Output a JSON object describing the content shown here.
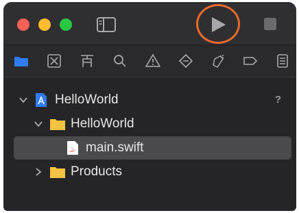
{
  "toolbar": {
    "run_icon": "play-icon",
    "stop_icon": "stop-icon",
    "sidebar_icon": "sidebar-icon"
  },
  "navigator": {
    "icons": [
      "folder-icon",
      "source-control-icon",
      "symbol-icon",
      "search-icon",
      "warning-icon",
      "test-icon",
      "debug-icon",
      "breakpoint-icon",
      "report-icon"
    ],
    "accent": "#2f7df6"
  },
  "tree": {
    "project": {
      "label": "HelloWorld",
      "badge": "?"
    },
    "group": {
      "label": "HelloWorld"
    },
    "file": {
      "label": "main.swift"
    },
    "products": {
      "label": "Products"
    }
  },
  "colors": {
    "highlight": "#ef6a2b",
    "folder": "#f5c242",
    "swift": "#f05138"
  }
}
